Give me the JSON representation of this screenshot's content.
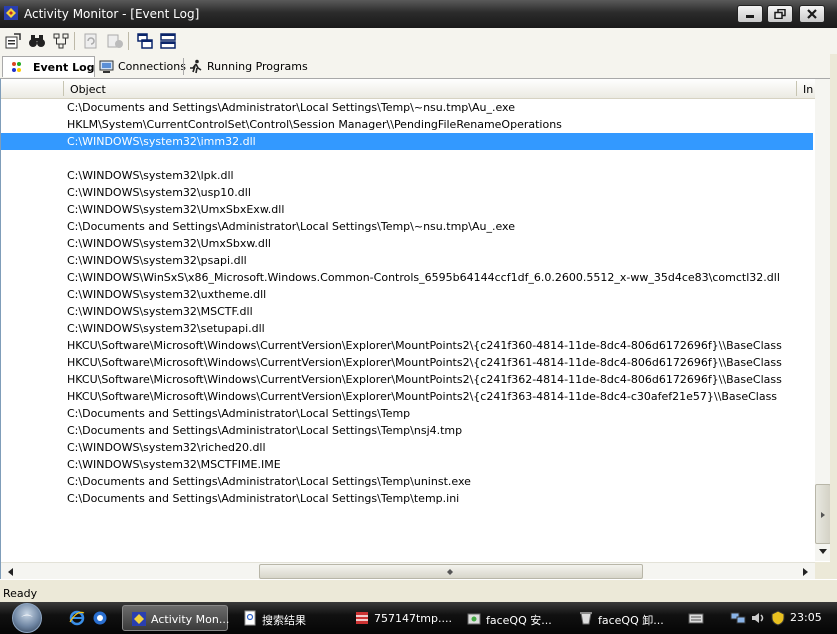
{
  "window": {
    "title": "Activity Monitor - [Event Log]"
  },
  "tabs": [
    {
      "label": "Event Log",
      "active": true
    },
    {
      "label": "Connections",
      "active": false
    },
    {
      "label": "Running Programs",
      "active": false
    }
  ],
  "list": {
    "columns": [
      {
        "label": "Object"
      },
      {
        "label": "In"
      }
    ],
    "rows": [
      "C:\\Documents and Settings\\Administrator\\Local Settings\\Temp\\~nsu.tmp\\Au_.exe",
      "HKLM\\System\\CurrentControlSet\\Control\\Session Manager\\\\PendingFileRenameOperations",
      "C:\\WINDOWS\\system32\\imm32.dll",
      "",
      "C:\\WINDOWS\\system32\\lpk.dll",
      "C:\\WINDOWS\\system32\\usp10.dll",
      "C:\\WINDOWS\\system32\\UmxSbxExw.dll",
      "C:\\Documents and Settings\\Administrator\\Local Settings\\Temp\\~nsu.tmp\\Au_.exe",
      "C:\\WINDOWS\\system32\\UmxSbxw.dll",
      "C:\\WINDOWS\\system32\\psapi.dll",
      "C:\\WINDOWS\\WinSxS\\x86_Microsoft.Windows.Common-Controls_6595b64144ccf1df_6.0.2600.5512_x-ww_35d4ce83\\comctl32.dll",
      "C:\\WINDOWS\\system32\\uxtheme.dll",
      "C:\\WINDOWS\\system32\\MSCTF.dll",
      "C:\\WINDOWS\\system32\\setupapi.dll",
      "HKCU\\Software\\Microsoft\\Windows\\CurrentVersion\\Explorer\\MountPoints2\\{c241f360-4814-11de-8dc4-806d6172696f}\\\\BaseClass",
      "HKCU\\Software\\Microsoft\\Windows\\CurrentVersion\\Explorer\\MountPoints2\\{c241f361-4814-11de-8dc4-806d6172696f}\\\\BaseClass",
      "HKCU\\Software\\Microsoft\\Windows\\CurrentVersion\\Explorer\\MountPoints2\\{c241f362-4814-11de-8dc4-806d6172696f}\\\\BaseClass",
      "HKCU\\Software\\Microsoft\\Windows\\CurrentVersion\\Explorer\\MountPoints2\\{c241f363-4814-11de-8dc4-c30afef21e57}\\\\BaseClass",
      "C:\\Documents and Settings\\Administrator\\Local Settings\\Temp",
      "C:\\Documents and Settings\\Administrator\\Local Settings\\Temp\\nsj4.tmp",
      "C:\\WINDOWS\\system32\\riched20.dll",
      "C:\\WINDOWS\\system32\\MSCTFIME.IME",
      "C:\\Documents and Settings\\Administrator\\Local Settings\\Temp\\uninst.exe",
      "C:\\Documents and Settings\\Administrator\\Local Settings\\Temp\\temp.ini"
    ],
    "selected_index": 2
  },
  "statusbar": {
    "text": "Ready"
  },
  "taskbar": {
    "tasks": [
      {
        "label": "Activity Mon...",
        "active": true
      },
      {
        "label": "搜索结果",
        "active": false
      },
      {
        "label": "757147tmp....",
        "active": false
      },
      {
        "label": "faceQQ 安...",
        "active": false
      },
      {
        "label": "faceQQ 卸...",
        "active": false
      }
    ],
    "clock": "23:05"
  },
  "colors": {
    "selection": "#3399ff",
    "titlebar": "#2b2b2b"
  }
}
